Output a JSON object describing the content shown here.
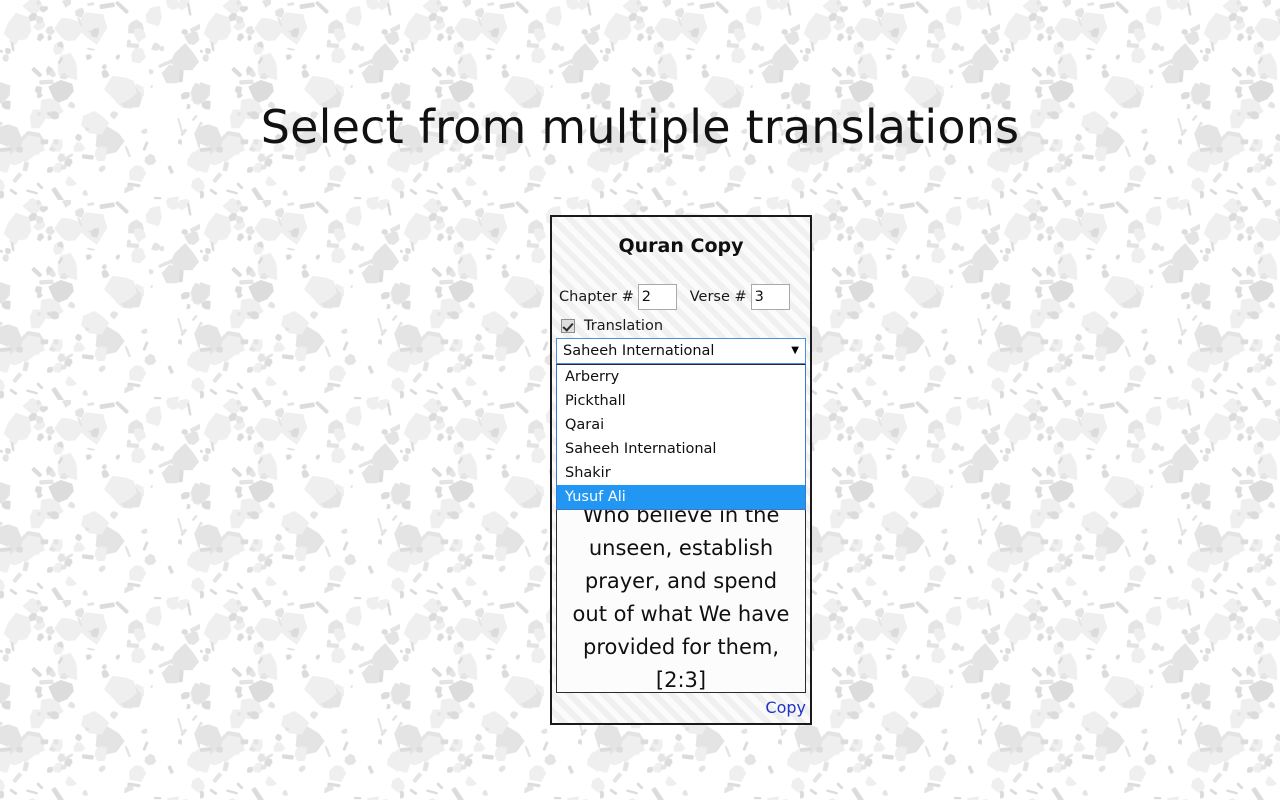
{
  "page": {
    "heading": "Select from multiple translations",
    "background_pattern": "terrazzo-confetti",
    "background_color": "#ffffff",
    "pattern_color": "#e8e8e8"
  },
  "popup": {
    "title": "Quran Copy",
    "background_pattern": "diagonal-stripes",
    "border_color": "#1a1a1a",
    "fields": {
      "chapter_label": "Chapter #",
      "chapter_value": "2",
      "verse_label": "Verse #",
      "verse_value": "3"
    },
    "translation_checkbox": {
      "label": "Translation",
      "checked": true,
      "icon": "checkmark-icon"
    },
    "translation_select": {
      "selected": "Saheeh International",
      "arrow_icon": "chevron-down-icon",
      "focus_color": "#4a90e2",
      "open": true,
      "highlight_color": "#2196f3",
      "options": [
        "Arberry",
        "Pickthall",
        "Qarai",
        "Saheeh International",
        "Shakir",
        "Yusuf Ali"
      ],
      "highlighted_option": "Yusuf Ali"
    },
    "verse_output": {
      "text": "Who believe in the unseen, establish prayer, and spend out of what We have provided for them, [2:3]",
      "reference": "[2:3]"
    },
    "copy_link": {
      "label": "Copy",
      "color": "#2134c8"
    }
  }
}
